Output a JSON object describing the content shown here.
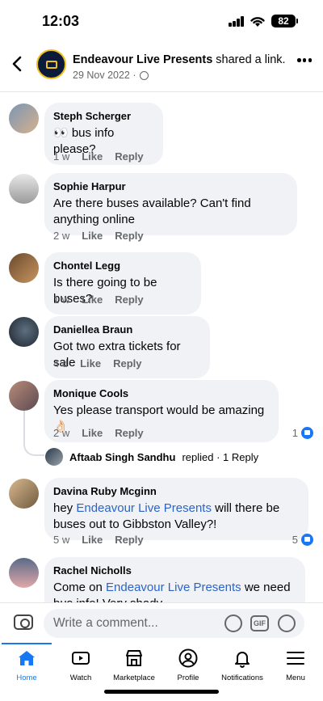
{
  "status": {
    "time": "12:03",
    "battery": "82"
  },
  "header": {
    "page_name": "Endeavour Live Presents",
    "action": " shared a link.",
    "date": "29 Nov 2022 ·"
  },
  "comments": [
    {
      "author": "Steph Scherger",
      "text_parts": [
        "👀 bus info please?"
      ],
      "time": "1 w",
      "like": "Like",
      "reply": "Reply"
    },
    {
      "author": "Sophie Harpur",
      "text_parts": [
        "Are there buses available? Can't find anything online"
      ],
      "time": "2 w",
      "like": "Like",
      "reply": "Reply"
    },
    {
      "author": "Chontel Legg",
      "text_parts": [
        "Is there going to be buses?"
      ],
      "time": "1 w",
      "like": "Like",
      "reply": "Reply"
    },
    {
      "author": "Daniellea Braun",
      "text_parts": [
        "Got two extra tickets for sale"
      ],
      "time": "4 d",
      "like": "Like",
      "reply": "Reply"
    },
    {
      "author": "Monique Cools",
      "text_parts": [
        "Yes please transport would be amazing👌🏻"
      ],
      "time": "2 w",
      "like": "Like",
      "reply": "Reply",
      "reactions": "1"
    },
    {
      "author": "Davina Ruby Mcginn",
      "text_before": "hey ",
      "mention": "Endeavour Live Presents",
      "text_after": " will there be buses out to Gibbston Valley?!",
      "time": "5 w",
      "like": "Like",
      "reply": "Reply",
      "reactions": "5"
    },
    {
      "author": "Rachel Nicholls",
      "text_before": "Come on ",
      "mention": "Endeavour Live Presents",
      "text_after": " we need bus info! Very shady.."
    }
  ],
  "reply_summary": {
    "name": "Aftaab Singh Sandhu",
    "text": "replied · 1 Reply"
  },
  "composer": {
    "placeholder": "Write a comment...",
    "gif": "GIF"
  },
  "tabs": [
    "Home",
    "Watch",
    "Marketplace",
    "Profile",
    "Notifications",
    "Menu"
  ],
  "colors": {
    "accent": "#1877f2",
    "mention": "#2c64c6",
    "bubble": "#f0f2f5"
  }
}
